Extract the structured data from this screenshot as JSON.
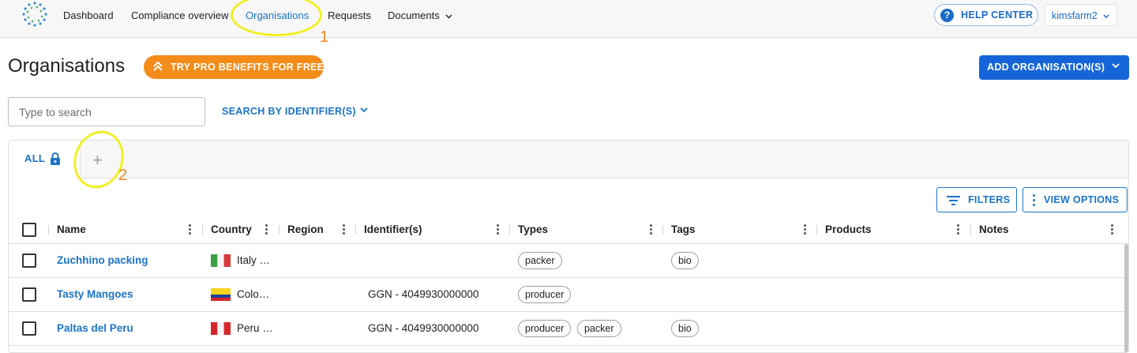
{
  "nav": {
    "items": [
      "Dashboard",
      "Compliance overview",
      "Organisations",
      "Requests",
      "Documents"
    ],
    "active": "Organisations",
    "help_label": "HELP CENTER",
    "help_icon": "question-circle-icon",
    "user_label": "kimsfarm2"
  },
  "page": {
    "title": "Organisations",
    "pro_label": "TRY PRO BENEFITS FOR FREE",
    "add_label": "ADD ORGANISATION(S)"
  },
  "search": {
    "placeholder": "Type to search",
    "by_identifier_label": "SEARCH BY IDENTIFIER(S)"
  },
  "tabs": {
    "all_label": "ALL",
    "add_label": "+"
  },
  "toolbar": {
    "filters_label": "FILTERS",
    "view_options_label": "VIEW OPTIONS"
  },
  "table": {
    "columns": [
      "Name",
      "Country",
      "Region",
      "Identifier(s)",
      "Types",
      "Tags",
      "Products",
      "Notes"
    ],
    "rows": [
      {
        "name": "Zuchhino packing",
        "country": "Italy …",
        "flag": "italy",
        "identifier": "",
        "types": [
          "packer"
        ],
        "tags": [
          "bio"
        ]
      },
      {
        "name": "Tasty Mangoes",
        "country": "Colo…",
        "flag": "colombia",
        "identifier": "GGN - 4049930000000",
        "types": [
          "producer"
        ],
        "tags": []
      },
      {
        "name": "Paltas del Peru",
        "country": "Peru …",
        "flag": "peru",
        "identifier": "GGN - 4049930000000",
        "types": [
          "producer",
          "packer"
        ],
        "tags": [
          "bio"
        ]
      }
    ]
  },
  "annotations": [
    "1",
    "2"
  ],
  "colors": {
    "accent": "#1a73c9",
    "primary_button": "#1565d8",
    "pro_button": "#f48c1a",
    "annotation_ring": "#f0f022",
    "annotation_number": "#f08a1c"
  }
}
